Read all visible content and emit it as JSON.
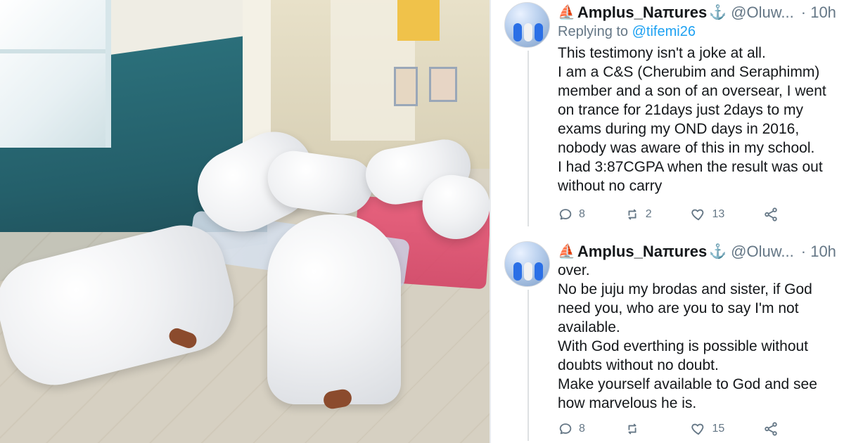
{
  "tweets": [
    {
      "display_name": "Amplus_Naπures",
      "name_prefix_glyph": "⛵",
      "name_suffix_glyph": "⚓",
      "handle": "@Oluw...",
      "time": "· 10h",
      "replying_prefix": "Replying to",
      "replying_mention": "@tifemi26",
      "text_lines": [
        "This testimony isn't a joke at all.",
        "I am a C&S (Cherubim and Seraphimm)",
        "member and a son of an oversear, I went",
        "on trance for 21days just 2days to my",
        "exams during my OND days in 2016,",
        "nobody was aware of this in my school.",
        "I had 3:87CGPA when the result was out",
        "without no carry"
      ],
      "actions": {
        "reply_count": "8",
        "retweet_count": "2",
        "like_count": "13",
        "share_count": ""
      }
    },
    {
      "display_name": "Amplus_Naπures",
      "name_prefix_glyph": "⛵",
      "name_suffix_glyph": "⚓",
      "handle": "@Oluw...",
      "time": "· 10h",
      "text_lines": [
        "over.",
        "No be juju my brodas and sister, if God",
        "need you, who are you to say I'm not",
        "available.",
        "With God everthing is possible without",
        "doubts without no doubt.",
        "Make yourself available to God and see",
        "how marvelous he is."
      ],
      "actions": {
        "reply_count": "8",
        "retweet_count": "",
        "like_count": "15",
        "share_count": ""
      }
    }
  ],
  "colors": {
    "text_primary": "#14171a",
    "text_secondary": "#657786",
    "link": "#1da1f2",
    "divider": "#e9ecef"
  },
  "icons": {
    "reply": "reply-icon",
    "retweet": "retweet-icon",
    "like": "heart-icon",
    "share": "share-icon",
    "chevron": "chevron-down-icon"
  }
}
